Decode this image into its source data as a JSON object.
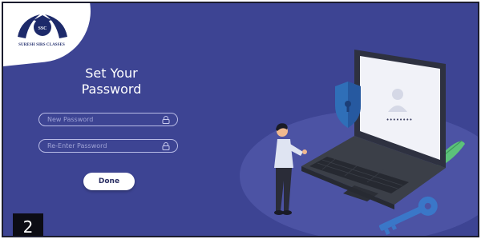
{
  "logo": {
    "text": "SURESH SIRS CLASSES"
  },
  "form": {
    "title_line1": "Set Your",
    "title_line2": "Password",
    "new_password_placeholder": "New Password",
    "reenter_password_placeholder": "Re-Enter Password",
    "done_label": "Done"
  },
  "illustration": {
    "password_mask": "••••••••"
  },
  "step": {
    "number": "2"
  },
  "colors": {
    "background": "#3d4493",
    "field_border": "#b8bbe6",
    "button_bg": "#ffffff",
    "laptop_body": "#3a3e47",
    "shield": "#2f6fb8",
    "key": "#3a77c8"
  },
  "icons": [
    "logo-emblem",
    "lock-icon",
    "shield-keyhole-icon",
    "user-avatar-icon",
    "key-icon",
    "leaf-icon"
  ]
}
